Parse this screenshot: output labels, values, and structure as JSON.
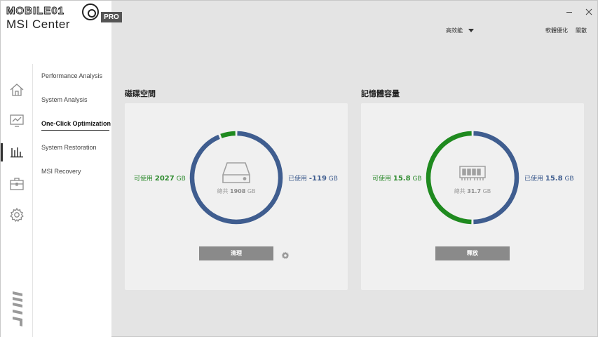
{
  "app": {
    "logo_top": "MOBILE01",
    "logo_pro": "PRO",
    "logo_bottom": "MSI Center"
  },
  "topbar": {
    "mode_label": "高效能",
    "update_label": "軟體優化",
    "about_label": "關散"
  },
  "menu": {
    "items": [
      {
        "label": "Performance Analysis"
      },
      {
        "label": "System Analysis"
      },
      {
        "label": "One-Click Optimization"
      },
      {
        "label": "System Restoration"
      },
      {
        "label": "MSI Recovery"
      }
    ],
    "active_index": 2
  },
  "disk": {
    "title": "磁碟空間",
    "available_prefix": "可使用",
    "available_value": "2027",
    "available_unit": "GB",
    "used_prefix": "已使用",
    "used_value": "-119",
    "used_unit": "GB",
    "total_prefix": "總共",
    "total_value": "1908",
    "total_unit": "GB",
    "used_fraction": 0.94,
    "button_label": "清理"
  },
  "memory": {
    "title": "記憶體容量",
    "available_prefix": "可使用",
    "available_value": "15.8",
    "available_unit": "GB",
    "used_prefix": "已使用",
    "used_value": "15.8",
    "used_unit": "GB",
    "total_prefix": "總共",
    "total_value": "31.7",
    "total_unit": "GB",
    "used_fraction": 0.5,
    "button_label": "釋放"
  },
  "colors": {
    "available": "#1f8a1f",
    "used": "#3f5d8f",
    "available_text": "#2e8b2e",
    "used_text": "#3f5d8f"
  }
}
